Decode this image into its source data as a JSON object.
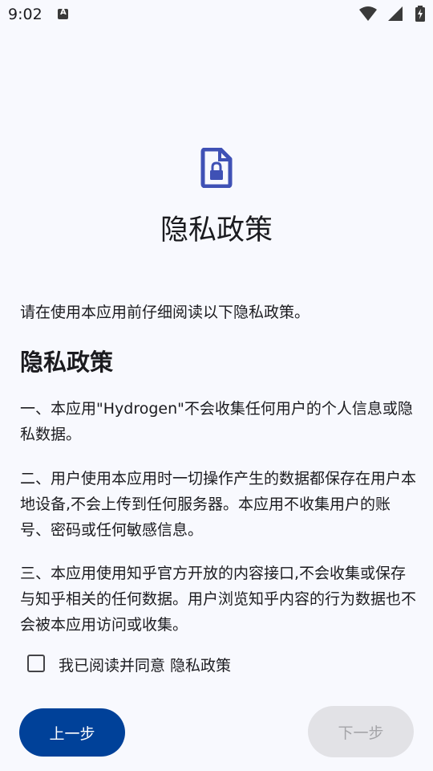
{
  "status_bar": {
    "time": "9:02",
    "notification_icon": "text-a-icon",
    "icons": [
      "wifi-icon",
      "cell-signal-icon",
      "battery-charging-icon"
    ]
  },
  "header": {
    "icon": "document-lock-icon",
    "title": "隐私政策"
  },
  "content": {
    "intro": "请在使用本应用前仔细阅读以下隐私政策。",
    "section_heading": "隐私政策",
    "paragraphs": [
      "一、本应用\"Hydrogen\"不会收集任何用户的个人信息或隐私数据。",
      "二、用户使用本应用时一切操作产生的数据都保存在用户本地设备,不会上传到任何服务器。本应用不收集用户的账号、密码或任何敏感信息。",
      "三、本应用使用知乎官方开放的内容接口,不会收集或保存与知乎相关的任何数据。用户浏览知乎内容的行为数据也不会被本应用访问或收集。"
    ]
  },
  "agreement": {
    "label": "我已阅读并同意 隐私政策",
    "checked": false
  },
  "buttons": {
    "prev_label": "上一步",
    "next_label": "下一步",
    "next_enabled": false
  },
  "colors": {
    "primary": "#004199",
    "icon_accent": "#3f51b5",
    "background": "#f8f9fe",
    "disabled_bg": "#e2e2e6",
    "disabled_text": "#a4a4a8"
  }
}
